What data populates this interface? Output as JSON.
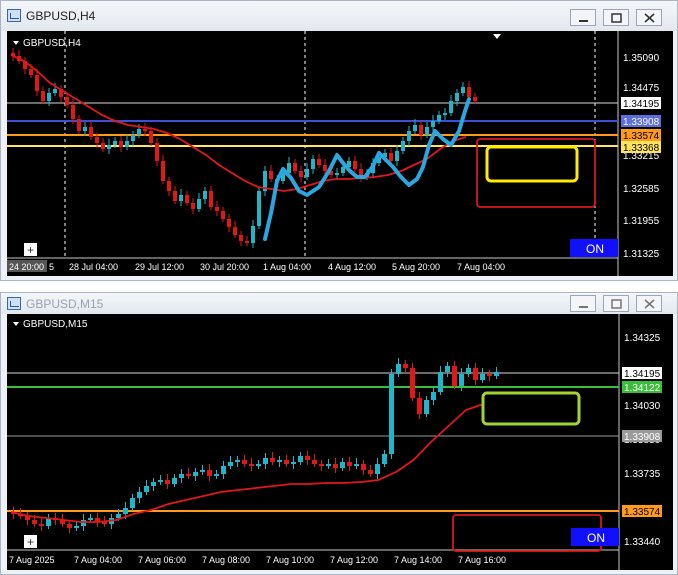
{
  "windows": [
    {
      "title": "GBPUSD,H4",
      "active": true,
      "chart_label": "GBPUSD,H4",
      "price_axis": [
        "1.35090",
        "1.34475",
        "1.33215",
        "1.32585",
        "1.31955",
        "1.31325"
      ],
      "time_axis": [
        "24 20:00",
        "5",
        "28 Jul 04:00",
        "29 Jul 12:00",
        "30 Jul 20:00",
        "1 Aug 04:00",
        "4 Aug 12:00",
        "5 Aug 20:00",
        "7 Aug 04:00"
      ],
      "price_tags": [
        {
          "label": "1.34195",
          "color": "#ffffff",
          "text_color": "#000000"
        },
        {
          "label": "1.33908",
          "color": "#5a6ee0",
          "text_color": "#ffffff"
        },
        {
          "label": "1.33574",
          "color": "#ff9a1a",
          "text_color": "#000000"
        },
        {
          "label": "1.33368",
          "color": "#ffe45c",
          "text_color": "#000000"
        }
      ],
      "button_label": "ON",
      "plus_label": "+"
    },
    {
      "title": "GBPUSD,M15",
      "active": false,
      "chart_label": "GBPUSD,M15",
      "price_axis": [
        "1.34325",
        "1.34030",
        "1.33830",
        "1.33735",
        "1.33440"
      ],
      "time_axis": [
        "7 Aug 2025",
        "7 Aug 04:00",
        "7 Aug 06:00",
        "7 Aug 08:00",
        "7 Aug 10:00",
        "7 Aug 12:00",
        "7 Aug 14:00",
        "7 Aug 16:00"
      ],
      "price_tags": [
        {
          "label": "1.34195",
          "color": "#ffffff",
          "text_color": "#000000"
        },
        {
          "label": "1.34122",
          "color": "#3bbf3b",
          "text_color": "#ffffff"
        },
        {
          "label": "1.33908",
          "color": "#9a9a9a",
          "text_color": "#ffffff"
        },
        {
          "label": "1.33574",
          "color": "#ff9a1a",
          "text_color": "#000000"
        }
      ],
      "button_label": "ON",
      "plus_label": "+"
    }
  ],
  "colors": {
    "bull": "#1fb6c9",
    "bear": "#e01818",
    "ma_line": "#e01818",
    "annotation_line": "#2aa7e0",
    "box_yellow": "#ffea00",
    "box_green": "#a4d233",
    "box_red": "#d81818"
  }
}
